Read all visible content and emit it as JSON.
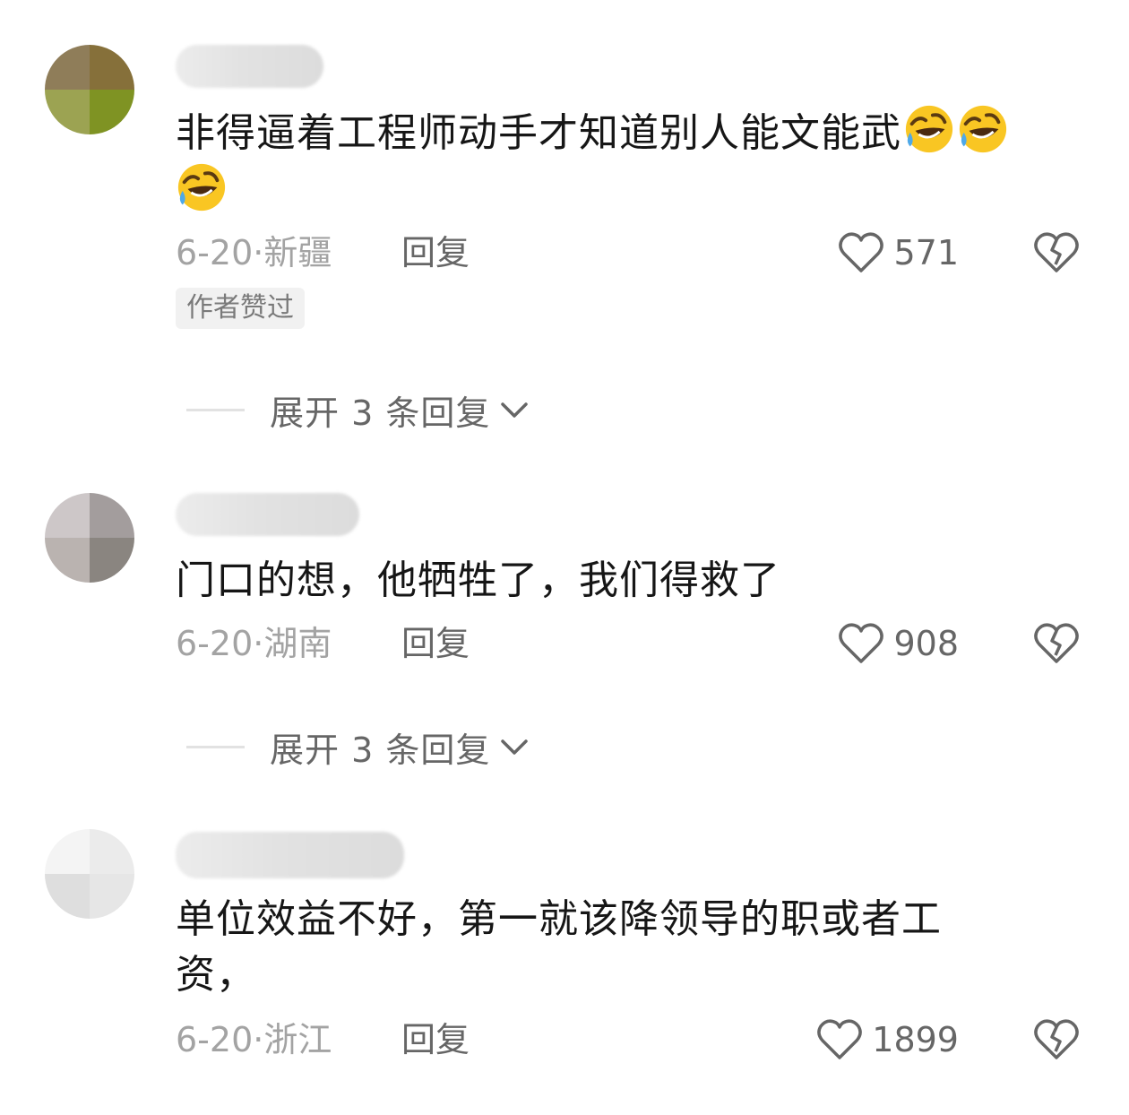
{
  "comments": [
    {
      "avatar_colors": [
        "#8f7d59",
        "#86703a",
        "#9ca352",
        "#7f9323"
      ],
      "text": "非得逼着工程师动手才知道别人能文能武",
      "emoji_name": "rolling-on-floor-laughing-emoji",
      "emoji_count": 3,
      "date": "6-20",
      "location": "新疆",
      "reply_label": "回复",
      "likes": "571",
      "badge": "作者赞过",
      "expand_label": "展开 3 条回复"
    },
    {
      "avatar_colors": [
        "#cdc7c8",
        "#a39d9d",
        "#bab3b0",
        "#8a8580"
      ],
      "text": "门口的想，他牺牲了，我们得救了",
      "date": "6-20",
      "location": "湖南",
      "reply_label": "回复",
      "likes": "908",
      "expand_label": "展开 3 条回复"
    },
    {
      "avatar_colors": [
        "#f4f4f4",
        "#ebebeb",
        "#dedede",
        "#e6e6e6"
      ],
      "text": "单位效益不好，第一就该降领导的职或者工资，",
      "date": "6-20",
      "location": "浙江",
      "reply_label": "回复",
      "likes": "1899"
    }
  ],
  "icons": {
    "like": "heart-outline-icon",
    "dislike": "broken-heart-icon",
    "expand": "chevron-down-icon"
  },
  "colors": {
    "text": "#161616",
    "meta": "#a3a3a3",
    "action": "#666666",
    "emoji_face": "#f9c623"
  }
}
